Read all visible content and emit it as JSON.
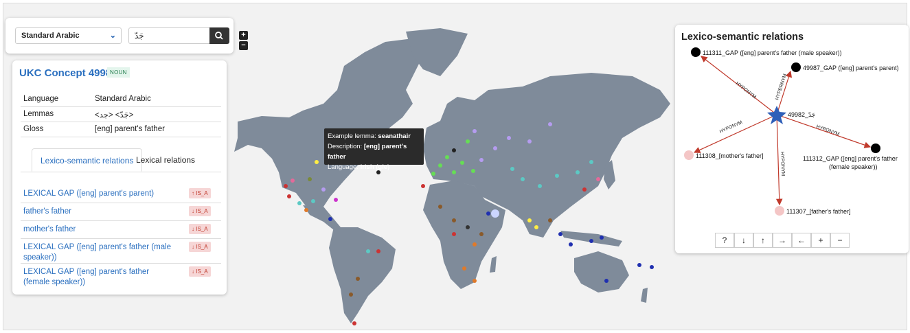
{
  "search": {
    "language": "Standard Arabic",
    "query": "جَدّ"
  },
  "zoom": {
    "plus": "+",
    "minus": "−"
  },
  "concept": {
    "title": "UKC Concept 49982",
    "pos": "NOUN",
    "rows": [
      {
        "key": "Language",
        "value": "Standard Arabic"
      },
      {
        "key": "Lemmas",
        "value": "<جَدّ> <جد>"
      },
      {
        "key": "Gloss",
        "value": "[eng] parent's father"
      }
    ],
    "tabs": [
      "Lexico-semantic relations",
      "Lexical relations"
    ],
    "relations": [
      {
        "label": "LEXICAL GAP ([eng] parent's parent)",
        "badge": "↑ IS_A",
        "direction": "up"
      },
      {
        "label": "father's father",
        "badge": "↓ IS_A",
        "direction": "down"
      },
      {
        "label": "mother's father",
        "badge": "↓ IS_A",
        "direction": "down"
      },
      {
        "label": "LEXICAL GAP ([eng] parent's father (male speaker))",
        "badge": "↓ IS_A",
        "direction": "down"
      },
      {
        "label": "LEXICAL GAP ([eng] parent's father (female speaker))",
        "badge": "↓ IS_A",
        "direction": "down"
      }
    ]
  },
  "tooltip": {
    "lemma_label": "Example lemma:",
    "lemma_value": "seanathair",
    "desc_label": "Description:",
    "desc_value": "[eng] parent's father",
    "lang_label": "Language:",
    "lang_value": "Irish (gle)"
  },
  "graph": {
    "title": "Lexico-semantic relations",
    "center_label": "49982_جَدّ",
    "edge_label_hypernym": "HYPERNYM",
    "edge_label_hyponym": "HYPONYM",
    "nodes": [
      {
        "id": "n1",
        "label": "111311_GAP ([eng] parent's father (male speaker))",
        "color": "#000000"
      },
      {
        "id": "n2",
        "label": "49987_GAP ([eng] parent's parent)",
        "color": "#000000"
      },
      {
        "id": "n3",
        "label": "111308_[mother's father]",
        "color": "#f4c6c6"
      },
      {
        "id": "n4",
        "label_line1": "111312_GAP ([eng] parent's father",
        "label_line2": "(female speaker))",
        "color": "#000000"
      },
      {
        "id": "n5",
        "label": "111307_[father's father]",
        "color": "#f4c6c6"
      }
    ],
    "toolbar": [
      "?",
      "↓",
      "↑",
      "→",
      "←",
      "+",
      "−"
    ]
  },
  "colors": {
    "land": "#7f8b9a",
    "ocean": "#f2f2f2",
    "accent": "#2a6fbf",
    "edge": "#c0392b"
  }
}
